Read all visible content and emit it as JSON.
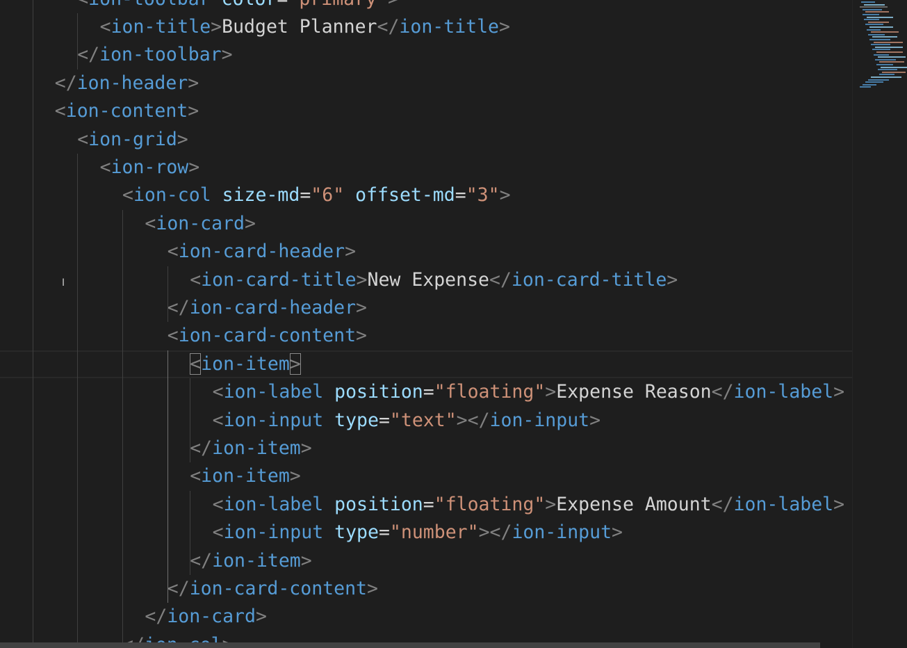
{
  "editor": {
    "language": "html",
    "lines": [
      {
        "indent": 3,
        "parts": [
          {
            "t": "br",
            "v": "<"
          },
          {
            "t": "tag",
            "v": "ion-toolbar"
          },
          {
            "t": "txt",
            "v": " "
          },
          {
            "t": "attr",
            "v": "color"
          },
          {
            "t": "eq",
            "v": "="
          },
          {
            "t": "str",
            "v": "\"primary\""
          },
          {
            "t": "br",
            "v": ">"
          }
        ]
      },
      {
        "indent": 4,
        "parts": [
          {
            "t": "br",
            "v": "<"
          },
          {
            "t": "tag",
            "v": "ion-title"
          },
          {
            "t": "br",
            "v": ">"
          },
          {
            "t": "txt",
            "v": "Budget Planner"
          },
          {
            "t": "br",
            "v": "</"
          },
          {
            "t": "tag",
            "v": "ion-title"
          },
          {
            "t": "br",
            "v": ">"
          }
        ]
      },
      {
        "indent": 3,
        "parts": [
          {
            "t": "br",
            "v": "</"
          },
          {
            "t": "tag",
            "v": "ion-toolbar"
          },
          {
            "t": "br",
            "v": ">"
          }
        ]
      },
      {
        "indent": 2,
        "parts": [
          {
            "t": "br",
            "v": "</"
          },
          {
            "t": "tag",
            "v": "ion-header"
          },
          {
            "t": "br",
            "v": ">"
          }
        ]
      },
      {
        "indent": 2,
        "parts": [
          {
            "t": "br",
            "v": "<"
          },
          {
            "t": "tag",
            "v": "ion-content"
          },
          {
            "t": "br",
            "v": ">"
          }
        ]
      },
      {
        "indent": 3,
        "parts": [
          {
            "t": "br",
            "v": "<"
          },
          {
            "t": "tag",
            "v": "ion-grid"
          },
          {
            "t": "br",
            "v": ">"
          }
        ]
      },
      {
        "indent": 4,
        "parts": [
          {
            "t": "br",
            "v": "<"
          },
          {
            "t": "tag",
            "v": "ion-row"
          },
          {
            "t": "br",
            "v": ">"
          }
        ]
      },
      {
        "indent": 5,
        "parts": [
          {
            "t": "br",
            "v": "<"
          },
          {
            "t": "tag",
            "v": "ion-col"
          },
          {
            "t": "txt",
            "v": " "
          },
          {
            "t": "attr",
            "v": "size-md"
          },
          {
            "t": "eq",
            "v": "="
          },
          {
            "t": "str",
            "v": "\"6\""
          },
          {
            "t": "txt",
            "v": " "
          },
          {
            "t": "attr",
            "v": "offset-md"
          },
          {
            "t": "eq",
            "v": "="
          },
          {
            "t": "str",
            "v": "\"3\""
          },
          {
            "t": "br",
            "v": ">"
          }
        ]
      },
      {
        "indent": 6,
        "parts": [
          {
            "t": "br",
            "v": "<"
          },
          {
            "t": "tag",
            "v": "ion-card"
          },
          {
            "t": "br",
            "v": ">"
          }
        ]
      },
      {
        "indent": 7,
        "parts": [
          {
            "t": "br",
            "v": "<"
          },
          {
            "t": "tag",
            "v": "ion-card-header"
          },
          {
            "t": "br",
            "v": ">"
          }
        ]
      },
      {
        "indent": 8,
        "parts": [
          {
            "t": "br",
            "v": "<"
          },
          {
            "t": "tag",
            "v": "ion-card-title"
          },
          {
            "t": "br",
            "v": ">"
          },
          {
            "t": "txt",
            "v": "New Expense"
          },
          {
            "t": "br",
            "v": "</"
          },
          {
            "t": "tag",
            "v": "ion-card-title"
          },
          {
            "t": "br",
            "v": ">"
          }
        ]
      },
      {
        "indent": 7,
        "parts": [
          {
            "t": "br",
            "v": "</"
          },
          {
            "t": "tag",
            "v": "ion-card-header"
          },
          {
            "t": "br",
            "v": ">"
          }
        ]
      },
      {
        "indent": 7,
        "parts": [
          {
            "t": "br",
            "v": "<"
          },
          {
            "t": "tag",
            "v": "ion-card-content"
          },
          {
            "t": "br",
            "v": ">"
          }
        ]
      },
      {
        "indent": 8,
        "current": true,
        "parts": [
          {
            "t": "br",
            "v": "<",
            "match": true
          },
          {
            "t": "tag",
            "v": "ion-item"
          },
          {
            "t": "br",
            "v": ">",
            "match": true
          }
        ]
      },
      {
        "indent": 9,
        "parts": [
          {
            "t": "br",
            "v": "<"
          },
          {
            "t": "tag",
            "v": "ion-label"
          },
          {
            "t": "txt",
            "v": " "
          },
          {
            "t": "attr",
            "v": "position"
          },
          {
            "t": "eq",
            "v": "="
          },
          {
            "t": "str",
            "v": "\"floating\""
          },
          {
            "t": "br",
            "v": ">"
          },
          {
            "t": "txt",
            "v": "Expense Reason"
          },
          {
            "t": "br",
            "v": "</"
          },
          {
            "t": "tag",
            "v": "ion-label"
          },
          {
            "t": "br",
            "v": ">"
          }
        ]
      },
      {
        "indent": 9,
        "parts": [
          {
            "t": "br",
            "v": "<"
          },
          {
            "t": "tag",
            "v": "ion-input"
          },
          {
            "t": "txt",
            "v": " "
          },
          {
            "t": "attr",
            "v": "type"
          },
          {
            "t": "eq",
            "v": "="
          },
          {
            "t": "str",
            "v": "\"text\""
          },
          {
            "t": "br",
            "v": "></"
          },
          {
            "t": "tag",
            "v": "ion-input"
          },
          {
            "t": "br",
            "v": ">"
          }
        ]
      },
      {
        "indent": 8,
        "parts": [
          {
            "t": "br",
            "v": "</"
          },
          {
            "t": "tag",
            "v": "ion-item"
          },
          {
            "t": "br",
            "v": ">"
          }
        ]
      },
      {
        "indent": 8,
        "parts": [
          {
            "t": "br",
            "v": "<"
          },
          {
            "t": "tag",
            "v": "ion-item"
          },
          {
            "t": "br",
            "v": ">"
          }
        ]
      },
      {
        "indent": 9,
        "parts": [
          {
            "t": "br",
            "v": "<"
          },
          {
            "t": "tag",
            "v": "ion-label"
          },
          {
            "t": "txt",
            "v": " "
          },
          {
            "t": "attr",
            "v": "position"
          },
          {
            "t": "eq",
            "v": "="
          },
          {
            "t": "str",
            "v": "\"floating\""
          },
          {
            "t": "br",
            "v": ">"
          },
          {
            "t": "txt",
            "v": "Expense Amount"
          },
          {
            "t": "br",
            "v": "</"
          },
          {
            "t": "tag",
            "v": "ion-label"
          },
          {
            "t": "br",
            "v": ">"
          }
        ]
      },
      {
        "indent": 9,
        "parts": [
          {
            "t": "br",
            "v": "<"
          },
          {
            "t": "tag",
            "v": "ion-input"
          },
          {
            "t": "txt",
            "v": " "
          },
          {
            "t": "attr",
            "v": "type"
          },
          {
            "t": "eq",
            "v": "="
          },
          {
            "t": "str",
            "v": "\"number\""
          },
          {
            "t": "br",
            "v": "></"
          },
          {
            "t": "tag",
            "v": "ion-input"
          },
          {
            "t": "br",
            "v": ">"
          }
        ]
      },
      {
        "indent": 8,
        "parts": [
          {
            "t": "br",
            "v": "</"
          },
          {
            "t": "tag",
            "v": "ion-item"
          },
          {
            "t": "br",
            "v": ">"
          }
        ]
      },
      {
        "indent": 7,
        "parts": [
          {
            "t": "br",
            "v": "</"
          },
          {
            "t": "tag",
            "v": "ion-card-content"
          },
          {
            "t": "br",
            "v": ">"
          }
        ]
      },
      {
        "indent": 6,
        "parts": [
          {
            "t": "br",
            "v": "</"
          },
          {
            "t": "tag",
            "v": "ion-card"
          },
          {
            "t": "br",
            "v": ">"
          }
        ]
      },
      {
        "indent": 5,
        "parts": [
          {
            "t": "br",
            "v": "</"
          },
          {
            "t": "tag",
            "v": "ion-col"
          },
          {
            "t": "br",
            "v": ">"
          }
        ]
      }
    ]
  },
  "cursor": {
    "icon": "text-cursor-icon",
    "glyph": "I"
  },
  "colors": {
    "background": "#1e1e1e",
    "tag": "#569cd6",
    "bracket": "#808080",
    "attribute": "#9cdcfe",
    "string": "#ce9178",
    "text": "#d4d4d4"
  }
}
